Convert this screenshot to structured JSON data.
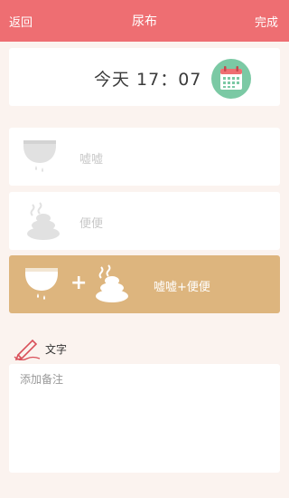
{
  "header": {
    "back_label": "返回",
    "title": "尿布",
    "done_label": "完成"
  },
  "time": {
    "text": "今天 17：07"
  },
  "options": [
    {
      "label": "嘘嘘",
      "icon": "diaper-icon"
    },
    {
      "label": "便便",
      "icon": "poop-icon"
    }
  ],
  "combo": {
    "label": "嘘嘘+便便",
    "plus": "+"
  },
  "note": {
    "heading": "文字",
    "placeholder": "添加备注",
    "value": ""
  },
  "colors": {
    "header": "#ee6e72",
    "combo": "#ddb57e",
    "calendar_circle": "#7bc9a4",
    "calendar_top": "#ee6e72",
    "icon_gray": "#e1e1e1",
    "pen": "#d9505a"
  }
}
